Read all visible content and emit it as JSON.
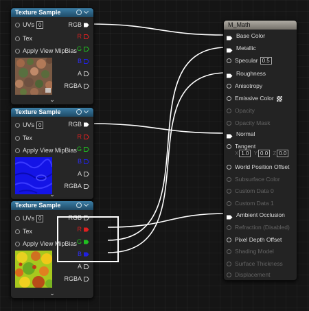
{
  "texture_nodes": [
    {
      "title": "Texture Sample",
      "inputs": [
        {
          "label": "UVs",
          "value": "0"
        },
        {
          "label": "Tex"
        },
        {
          "label": "Apply View MipBias"
        }
      ],
      "outputs": [
        "RGB",
        "R",
        "G",
        "B",
        "A",
        "RGBA"
      ],
      "thumbnail": "stone-rubble-texture"
    },
    {
      "title": "Texture Sample",
      "inputs": [
        {
          "label": "UVs",
          "value": "0"
        },
        {
          "label": "Tex"
        },
        {
          "label": "Apply View MipBias"
        }
      ],
      "outputs": [
        "RGB",
        "R",
        "G",
        "B",
        "A",
        "RGBA"
      ],
      "thumbnail": "blue-normal-map-texture"
    },
    {
      "title": "Texture Sample",
      "inputs": [
        {
          "label": "UVs",
          "value": "0"
        },
        {
          "label": "Tex"
        },
        {
          "label": "Apply View MipBias"
        }
      ],
      "outputs": [
        "RGB",
        "R",
        "G",
        "B",
        "A",
        "RGBA"
      ],
      "thumbnail": "orm-packed-texture"
    }
  ],
  "material": {
    "title": "M_Math",
    "pins": [
      {
        "label": "Base Color",
        "active": true
      },
      {
        "label": "Metallic",
        "active": true
      },
      {
        "label": "Specular",
        "active": true,
        "value": "0.5"
      },
      {
        "label": "Roughness",
        "active": true
      },
      {
        "label": "Anisotropy",
        "active": true
      },
      {
        "label": "Emissive Color",
        "active": true
      },
      {
        "label": "Opacity",
        "active": false
      },
      {
        "label": "Opacity Mask",
        "active": false
      },
      {
        "label": "Normal",
        "active": true
      },
      {
        "label": "Tangent",
        "active": true
      },
      {
        "label": "World Position Offset",
        "active": true
      },
      {
        "label": "Subsurface Color",
        "active": false
      },
      {
        "label": "Custom Data 0",
        "active": false
      },
      {
        "label": "Custom Data 1",
        "active": false
      },
      {
        "label": "Ambient Occlusion",
        "active": true
      },
      {
        "label": "Refraction (Disabled)",
        "active": false
      },
      {
        "label": "Pixel Depth Offset",
        "active": true
      },
      {
        "label": "Shading Model",
        "active": false
      },
      {
        "label": "Surface Thickness",
        "active": false
      },
      {
        "label": "Displacement",
        "active": false
      }
    ],
    "tangent": {
      "x_label": "X",
      "x": "1.0",
      "y_label": "Y",
      "y": "0.0",
      "z_label": "Z",
      "z": "0.0"
    }
  },
  "colors": {
    "header_blue": "#2f6a8e",
    "pin_red": "#e02020",
    "pin_green": "#20c020",
    "pin_blue": "#2020e0",
    "wire": "#ffffff",
    "highlight_box": "#ffffff"
  }
}
